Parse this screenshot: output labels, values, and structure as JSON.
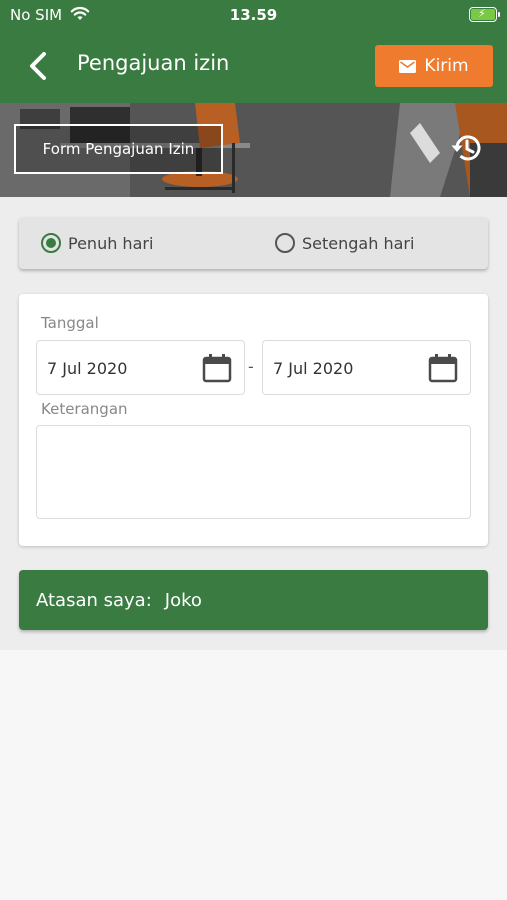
{
  "status_bar": {
    "carrier": "No SIM",
    "time": "13.59"
  },
  "header": {
    "title": "Pengajuan izin",
    "send_label": "Kirim"
  },
  "banner": {
    "form_label": "Form Pengajuan Izin"
  },
  "duration": {
    "options": [
      {
        "label": "Penuh hari",
        "checked": true
      },
      {
        "label": "Setengah hari",
        "checked": false
      }
    ]
  },
  "form": {
    "date_label": "Tanggal",
    "start_date": "7 Jul 2020",
    "separator": "-",
    "end_date": "7 Jul 2020",
    "note_label": "Keterangan",
    "note_value": ""
  },
  "supervisor": {
    "label": "Atasan saya:",
    "name": "Joko"
  },
  "colors": {
    "primary_green": "#3a7b41",
    "accent_orange": "#ee7b2e"
  }
}
